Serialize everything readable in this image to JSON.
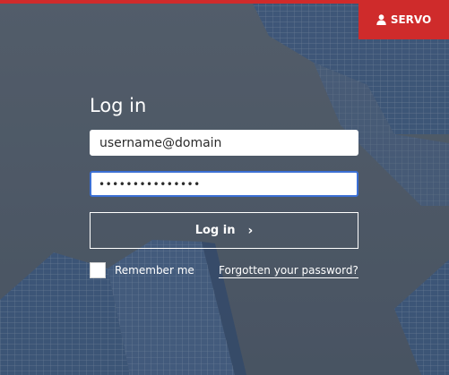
{
  "header": {
    "brand_label": "SERVO",
    "brand_icon": "user-icon",
    "accent_color": "#cf2b2b"
  },
  "login": {
    "title": "Log in",
    "username_value": "username@domain",
    "password_value": "•••••••••••••••",
    "submit_label": "Log in",
    "submit_icon": "chevron-right-icon",
    "remember_label": "Remember me",
    "remember_checked": false,
    "forgot_label": "Forgotten your password?",
    "focus_color": "#3b6fd4"
  }
}
